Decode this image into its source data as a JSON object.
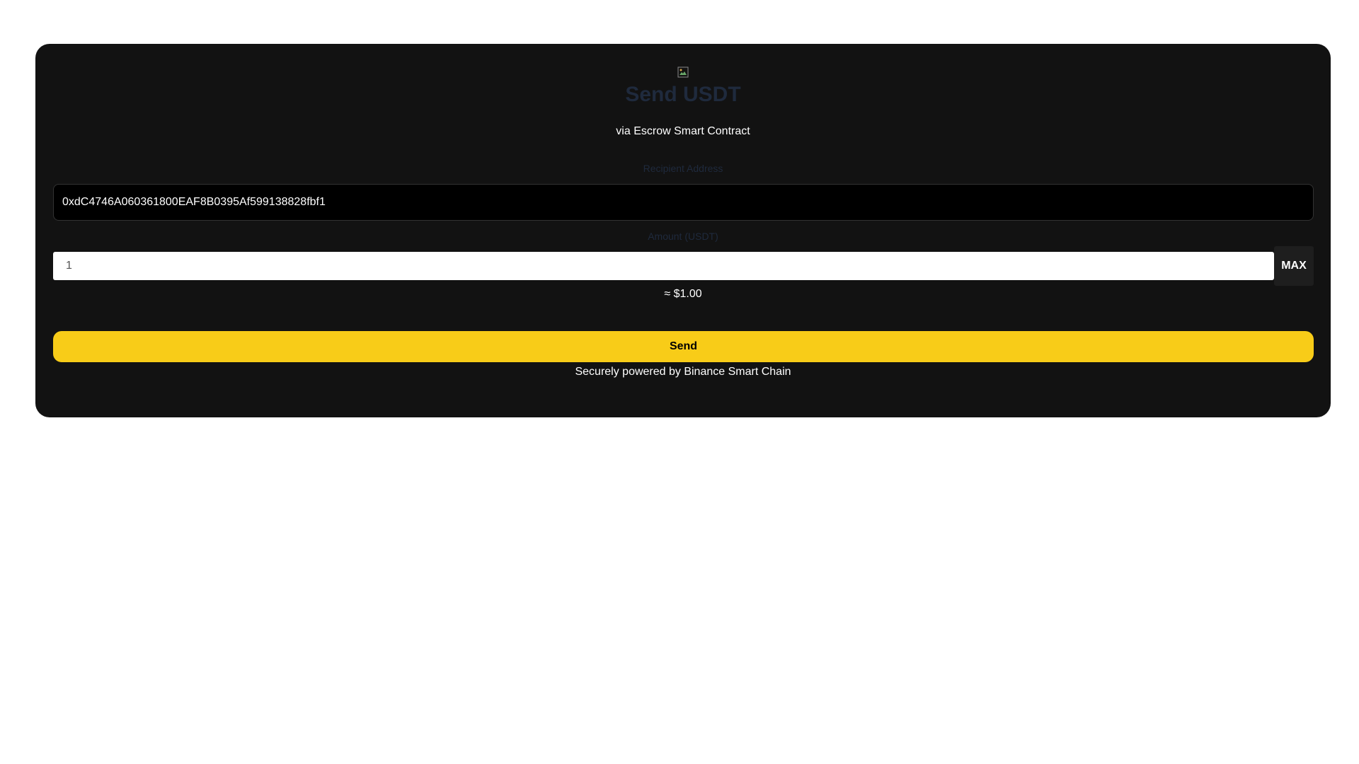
{
  "header": {
    "title": "Send USDT",
    "subtitle": "via Escrow Smart Contract",
    "logo_icon": "broken-image-icon"
  },
  "form": {
    "recipient_label": "Recipient Address",
    "recipient_value": "0xdC4746A060361800EAF8B0395Af599138828fbf1",
    "amount_label": "Amount (USDT)",
    "amount_value": "1",
    "max_label": "MAX",
    "approx_value": "≈ $1.00",
    "send_label": "Send"
  },
  "footer": {
    "text": "Securely powered by Binance Smart Chain"
  },
  "colors": {
    "card_bg": "#121212",
    "accent": "#f8cc18",
    "title": "#1f2a3d"
  }
}
